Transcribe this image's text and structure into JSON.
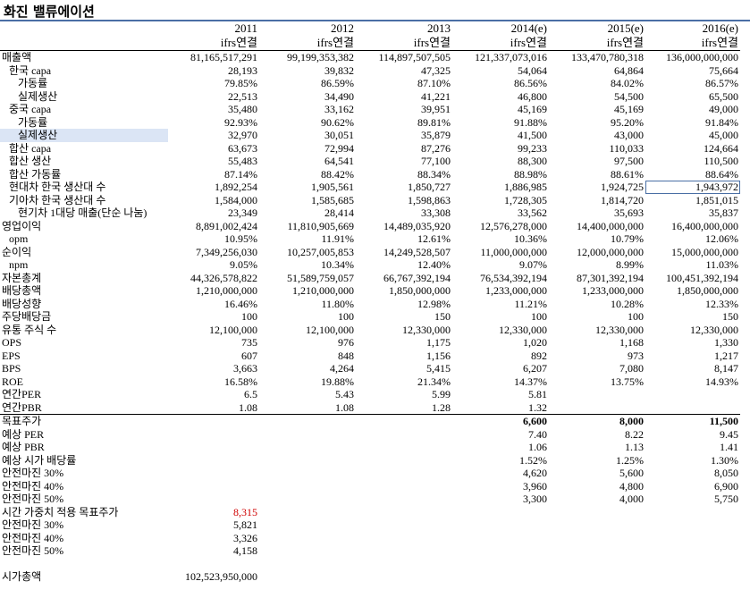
{
  "sheet": {
    "title": "화진 밸류에이션"
  },
  "header": {
    "years": [
      "2011",
      "2012",
      "2013",
      "2014(e)",
      "2015(e)",
      "2016(e)"
    ],
    "basis": [
      "ifrs연결",
      "ifrs연결",
      "ifrs연결",
      "ifrs연결",
      "ifrs연결",
      "ifrs연결"
    ]
  },
  "rows": [
    {
      "label": "매출액",
      "indent": 0,
      "values": [
        "81,165,517,291",
        "99,199,353,382",
        "114,897,507,505",
        "121,337,073,016",
        "133,470,780,318",
        "136,000,000,000"
      ]
    },
    {
      "label": "한국 capa",
      "indent": 1,
      "values": [
        "28,193",
        "39,832",
        "47,325",
        "54,064",
        "64,864",
        "75,664"
      ]
    },
    {
      "label": "가동률",
      "indent": 2,
      "values": [
        "79.85%",
        "86.59%",
        "87.10%",
        "86.56%",
        "84.02%",
        "86.57%"
      ]
    },
    {
      "label": "실제생산",
      "indent": 2,
      "values": [
        "22,513",
        "34,490",
        "41,221",
        "46,800",
        "54,500",
        "65,500"
      ]
    },
    {
      "label": "중국 capa",
      "indent": 1,
      "values": [
        "35,480",
        "33,162",
        "39,951",
        "45,169",
        "45,169",
        "49,000"
      ]
    },
    {
      "label": "가동률",
      "indent": 2,
      "values": [
        "92.93%",
        "90.62%",
        "89.81%",
        "91.88%",
        "95.20%",
        "91.84%"
      ]
    },
    {
      "label": "실제생산",
      "indent": 2,
      "values": [
        "32,970",
        "30,051",
        "35,879",
        "41,500",
        "43,000",
        "45,000"
      ]
    },
    {
      "label": "합산 capa",
      "indent": 1,
      "values": [
        "63,673",
        "72,994",
        "87,276",
        "99,233",
        "110,033",
        "124,664"
      ]
    },
    {
      "label": "합산 생산",
      "indent": 1,
      "values": [
        "55,483",
        "64,541",
        "77,100",
        "88,300",
        "97,500",
        "110,500"
      ]
    },
    {
      "label": "합산 가동률",
      "indent": 1,
      "values": [
        "87.14%",
        "88.42%",
        "88.34%",
        "88.98%",
        "88.61%",
        "88.64%"
      ]
    },
    {
      "label": "현대차 한국 생산대 수",
      "indent": 1,
      "values": [
        "1,892,254",
        "1,905,561",
        "1,850,727",
        "1,886,985",
        "1,924,725",
        "1,943,972"
      ]
    },
    {
      "label": "기아차 한국 생산대 수",
      "indent": 1,
      "values": [
        "1,584,000",
        "1,585,685",
        "1,598,863",
        "1,728,305",
        "1,814,720",
        "1,851,015"
      ]
    },
    {
      "label": "현기차 1대당 매출(단순 나눔)",
      "indent": 2,
      "values": [
        "23,349",
        "28,414",
        "33,308",
        "33,562",
        "35,693",
        "35,837"
      ]
    },
    {
      "label": "영업이익",
      "indent": 0,
      "values": [
        "8,891,002,424",
        "11,810,905,669",
        "14,489,035,920",
        "12,576,278,000",
        "14,400,000,000",
        "16,400,000,000"
      ]
    },
    {
      "label": "opm",
      "indent": 1,
      "values": [
        "10.95%",
        "11.91%",
        "12.61%",
        "10.36%",
        "10.79%",
        "12.06%"
      ]
    },
    {
      "label": "순이익",
      "indent": 0,
      "values": [
        "7,349,256,030",
        "10,257,005,853",
        "14,249,528,507",
        "11,000,000,000",
        "12,000,000,000",
        "15,000,000,000"
      ]
    },
    {
      "label": "npm",
      "indent": 1,
      "values": [
        "9.05%",
        "10.34%",
        "12.40%",
        "9.07%",
        "8.99%",
        "11.03%"
      ]
    },
    {
      "label": "자본총계",
      "indent": 0,
      "values": [
        "44,326,578,822",
        "51,589,759,057",
        "66,767,392,194",
        "76,534,392,194",
        "87,301,392,194",
        "100,451,392,194"
      ]
    },
    {
      "label": "배당총액",
      "indent": 0,
      "values": [
        "1,210,000,000",
        "1,210,000,000",
        "1,850,000,000",
        "1,233,000,000",
        "1,233,000,000",
        "1,850,000,000"
      ]
    },
    {
      "label": "배당성향",
      "indent": 0,
      "values": [
        "16.46%",
        "11.80%",
        "12.98%",
        "11.21%",
        "10.28%",
        "12.33%"
      ]
    },
    {
      "label": "주당배당금",
      "indent": 0,
      "values": [
        "100",
        "100",
        "150",
        "100",
        "100",
        "150"
      ]
    },
    {
      "label": "유통 주식 수",
      "indent": 0,
      "values": [
        "12,100,000",
        "12,100,000",
        "12,330,000",
        "12,330,000",
        "12,330,000",
        "12,330,000"
      ]
    },
    {
      "label": "OPS",
      "indent": 0,
      "values": [
        "735",
        "976",
        "1,175",
        "1,020",
        "1,168",
        "1,330"
      ]
    },
    {
      "label": "EPS",
      "indent": 0,
      "values": [
        "607",
        "848",
        "1,156",
        "892",
        "973",
        "1,217"
      ]
    },
    {
      "label": "BPS",
      "indent": 0,
      "values": [
        "3,663",
        "4,264",
        "5,415",
        "6,207",
        "7,080",
        "8,147"
      ]
    },
    {
      "label": "ROE",
      "indent": 0,
      "values": [
        "16.58%",
        "19.88%",
        "21.34%",
        "14.37%",
        "13.75%",
        "14.93%"
      ]
    },
    {
      "label": "연간PER",
      "indent": 0,
      "values": [
        "6.5",
        "5.43",
        "5.99",
        "5.81",
        "",
        ""
      ]
    },
    {
      "label": "연간PBR",
      "indent": 0,
      "values": [
        "1.08",
        "1.08",
        "1.28",
        "1.32",
        "",
        ""
      ]
    },
    {
      "label": "목표주가",
      "indent": 0,
      "values": [
        "",
        "",
        "",
        "6,600",
        "8,000",
        "11,500"
      ]
    },
    {
      "label": "예상 PER",
      "indent": 0,
      "values": [
        "",
        "",
        "",
        "7.40",
        "8.22",
        "9.45"
      ]
    },
    {
      "label": "예상 PBR",
      "indent": 0,
      "values": [
        "",
        "",
        "",
        "1.06",
        "1.13",
        "1.41"
      ]
    },
    {
      "label": "예상 시가 배당률",
      "indent": 0,
      "values": [
        "",
        "",
        "",
        "1.52%",
        "1.25%",
        "1.30%"
      ]
    },
    {
      "label": "안전마진 30%",
      "indent": 0,
      "values": [
        "",
        "",
        "",
        "4,620",
        "5,600",
        "8,050"
      ]
    },
    {
      "label": "안전마진 40%",
      "indent": 0,
      "values": [
        "",
        "",
        "",
        "3,960",
        "4,800",
        "6,900"
      ]
    },
    {
      "label": "안전마진 50%",
      "indent": 0,
      "values": [
        "",
        "",
        "",
        "3,300",
        "4,000",
        "5,750"
      ]
    },
    {
      "label": "시간 가중치 적용 목표주가",
      "indent": 0,
      "values": [
        "8,315",
        "",
        "",
        "",
        "",
        ""
      ]
    },
    {
      "label": "안전마진 30%",
      "indent": 0,
      "values": [
        "5,821",
        "",
        "",
        "",
        "",
        ""
      ]
    },
    {
      "label": "안전마진 40%",
      "indent": 0,
      "values": [
        "3,326",
        "",
        "",
        "",
        "",
        ""
      ]
    },
    {
      "label": "안전마진 50%",
      "indent": 0,
      "values": [
        "4,158",
        "",
        "",
        "",
        "",
        ""
      ]
    },
    {
      "label": "",
      "indent": 0,
      "values": [
        "",
        "",
        "",
        "",
        "",
        ""
      ]
    },
    {
      "label": "시가총액",
      "indent": 0,
      "values": [
        "102,523,950,000",
        "",
        "",
        "",
        "",
        ""
      ]
    }
  ],
  "styles": {
    "accent": "#4a6fa5",
    "highlight_red": "#d00000",
    "selection_fill": "#dbe5f5"
  }
}
